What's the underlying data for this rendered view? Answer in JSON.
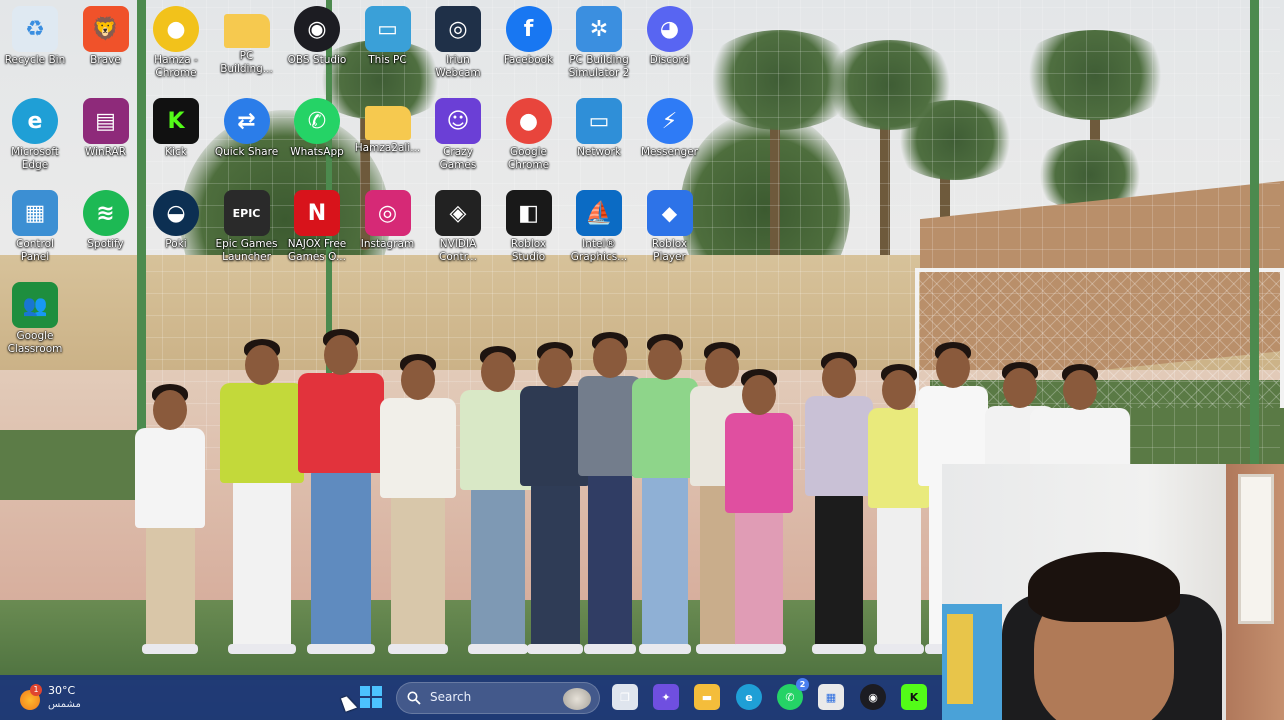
{
  "desktop": {
    "icons": [
      {
        "label": "Recycle Bin",
        "icon": "recycle-bin-icon",
        "color": "#dfe9f2",
        "glyph": "♻",
        "shortcut": false
      },
      {
        "label": "Brave",
        "icon": "brave-icon",
        "color": "#f0522a",
        "glyph": "🦁",
        "shortcut": true
      },
      {
        "label": "Hamza - Chrome",
        "icon": "chrome-profile-icon",
        "color": "#f2c21b",
        "glyph": "●",
        "shortcut": true
      },
      {
        "label": "PC Building...",
        "icon": "folder-icon",
        "color": "#f6c94f",
        "glyph": "",
        "shortcut": false
      },
      {
        "label": "OBS Studio",
        "icon": "obs-icon",
        "color": "#1c1c22",
        "glyph": "◉",
        "shortcut": true
      },
      {
        "label": "This PC",
        "icon": "monitor-icon",
        "color": "#3aa0d8",
        "glyph": "▭",
        "shortcut": false
      },
      {
        "label": "Iriun Webcam",
        "icon": "webcam-icon",
        "color": "#1f3048",
        "glyph": "◎",
        "shortcut": true
      },
      {
        "label": "Facebook",
        "icon": "facebook-icon",
        "color": "#1877f2",
        "glyph": "f",
        "shortcut": true
      },
      {
        "label": "PC Building Simulator 2",
        "icon": "fan-icon",
        "color": "#3b8fe0",
        "glyph": "✲",
        "shortcut": true
      },
      {
        "label": "Discord",
        "icon": "discord-icon",
        "color": "#5865f2",
        "glyph": "◕",
        "shortcut": true
      },
      {
        "label": "Microsoft Edge",
        "icon": "edge-icon",
        "color": "#1f9fd6",
        "glyph": "e",
        "shortcut": true
      },
      {
        "label": "WinRAR",
        "icon": "winrar-icon",
        "color": "#8e2a7a",
        "glyph": "▤",
        "shortcut": true
      },
      {
        "label": "Kick",
        "icon": "kick-icon",
        "color": "#111111",
        "glyph": "K",
        "shortcut": true
      },
      {
        "label": "Quick Share",
        "icon": "quick-share-icon",
        "color": "#2b7de9",
        "glyph": "⇄",
        "shortcut": true
      },
      {
        "label": "WhatsApp",
        "icon": "whatsapp-icon",
        "color": "#25d366",
        "glyph": "✆",
        "shortcut": true
      },
      {
        "label": "Hamza2ali...",
        "icon": "folder-icon",
        "color": "#f6c94f",
        "glyph": "",
        "shortcut": false
      },
      {
        "label": "Crazy Games",
        "icon": "crazy-games-icon",
        "color": "#6b3fd6",
        "glyph": "☺",
        "shortcut": true
      },
      {
        "label": "Google Chrome",
        "icon": "chrome-icon",
        "color": "#e8453c",
        "glyph": "●",
        "shortcut": true
      },
      {
        "label": "Network",
        "icon": "network-icon",
        "color": "#2f8fd8",
        "glyph": "▭",
        "shortcut": false
      },
      {
        "label": "Messenger",
        "icon": "messenger-icon",
        "color": "#2e7bf6",
        "glyph": "⚡",
        "shortcut": true
      },
      {
        "label": "Control Panel",
        "icon": "control-panel-icon",
        "color": "#3c8fd3",
        "glyph": "▦",
        "shortcut": true
      },
      {
        "label": "Spotify",
        "icon": "spotify-icon",
        "color": "#1db954",
        "glyph": "≋",
        "shortcut": true
      },
      {
        "label": "Poki",
        "icon": "poki-icon",
        "color": "#0c2f52",
        "glyph": "◒",
        "shortcut": true
      },
      {
        "label": "Epic Games Launcher",
        "icon": "epic-games-icon",
        "color": "#2a2a2a",
        "glyph": "EPIC",
        "shortcut": true
      },
      {
        "label": "NAJOX Free Games O...",
        "icon": "najox-icon",
        "color": "#d8131b",
        "glyph": "N",
        "shortcut": true
      },
      {
        "label": "Instagram",
        "icon": "instagram-icon",
        "color": "#d62976",
        "glyph": "◎",
        "shortcut": true
      },
      {
        "label": "NVIDIA Contr...",
        "icon": "nvidia-icon",
        "color": "#222222",
        "glyph": "◈",
        "shortcut": true
      },
      {
        "label": "Roblox Studio",
        "icon": "roblox-studio-icon",
        "color": "#191919",
        "glyph": "◧",
        "shortcut": true
      },
      {
        "label": "Intel® Graphics...",
        "icon": "intel-graphics-icon",
        "color": "#0b6bc4",
        "glyph": "⛵",
        "shortcut": true
      },
      {
        "label": "Roblox Player",
        "icon": "roblox-player-icon",
        "color": "#2d73e8",
        "glyph": "◆",
        "shortcut": true
      },
      {
        "label": "Google Classroom",
        "icon": "google-classroom-icon",
        "color": "#1e8e3e",
        "glyph": "👥",
        "shortcut": true
      }
    ]
  },
  "taskbar": {
    "weather": {
      "temp": "30°C",
      "desc": "مشمس",
      "badge": "1"
    },
    "search_placeholder": "Search",
    "apps": [
      {
        "name": "task-view",
        "icon": "task-view-icon",
        "color": "#dfe5ee",
        "glyph": "❐"
      },
      {
        "name": "msn",
        "icon": "msn-icon",
        "color": "#6f4fe0",
        "glyph": "✦"
      },
      {
        "name": "file-explorer",
        "icon": "file-explorer-icon",
        "color": "#f4bd3b",
        "glyph": "▬"
      },
      {
        "name": "edge",
        "icon": "edge-icon",
        "color": "#1f9fd6",
        "glyph": "e"
      },
      {
        "name": "whatsapp",
        "icon": "whatsapp-icon",
        "color": "#25d366",
        "glyph": "✆",
        "badge": "2"
      },
      {
        "name": "microsoft-store",
        "icon": "store-icon",
        "color": "#eaeaea",
        "glyph": "▦"
      },
      {
        "name": "obs-studio",
        "icon": "obs-icon",
        "color": "#1c1c22",
        "glyph": "◉"
      },
      {
        "name": "kick",
        "icon": "kick-icon",
        "color": "#53fc18",
        "glyph": "K"
      }
    ]
  }
}
